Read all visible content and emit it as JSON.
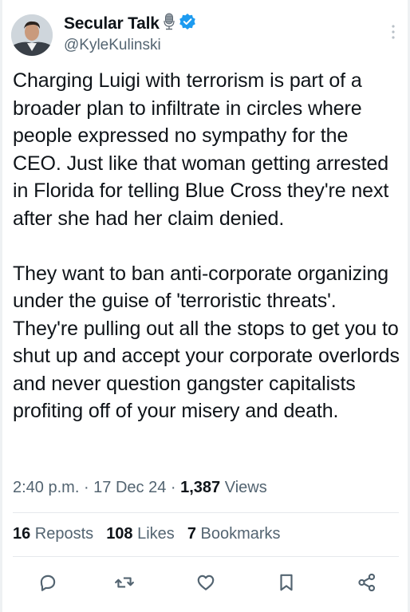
{
  "author": {
    "display_name": "Secular Talk",
    "handle": "@KyleKulinski",
    "verified": true,
    "emoji_name": "studio-microphone-icon",
    "badge_color": "#1d9bf0"
  },
  "tweet": {
    "text": "Charging Luigi with terrorism is part of a broader plan to infiltrate in circles where people expressed no sympathy for the CEO. Just like that woman getting arrested in Florida for telling Blue Cross they're next after she had her claim denied.\n\nThey want to ban anti-corporate organizing under the guise of 'terroristic threats'. They're pulling out all the stops to get you to shut up and accept your corporate overlords and never question gangster capitalists profiting off of your misery and death."
  },
  "meta": {
    "time": "2:40 p.m.",
    "separator": " · ",
    "date": "17 Dec 24",
    "views_count": "1,387",
    "views_label": " Views"
  },
  "stats": {
    "reposts_count": "16",
    "reposts_label": " Reposts",
    "likes_count": "108",
    "likes_label": " Likes",
    "bookmarks_count": "7",
    "bookmarks_label": " Bookmarks"
  },
  "actions": [
    "reply-icon",
    "repost-icon",
    "like-icon",
    "bookmark-icon",
    "share-icon"
  ],
  "colors": {
    "text": "#0f1419",
    "muted": "#536471",
    "divider": "#e6e9ec"
  }
}
